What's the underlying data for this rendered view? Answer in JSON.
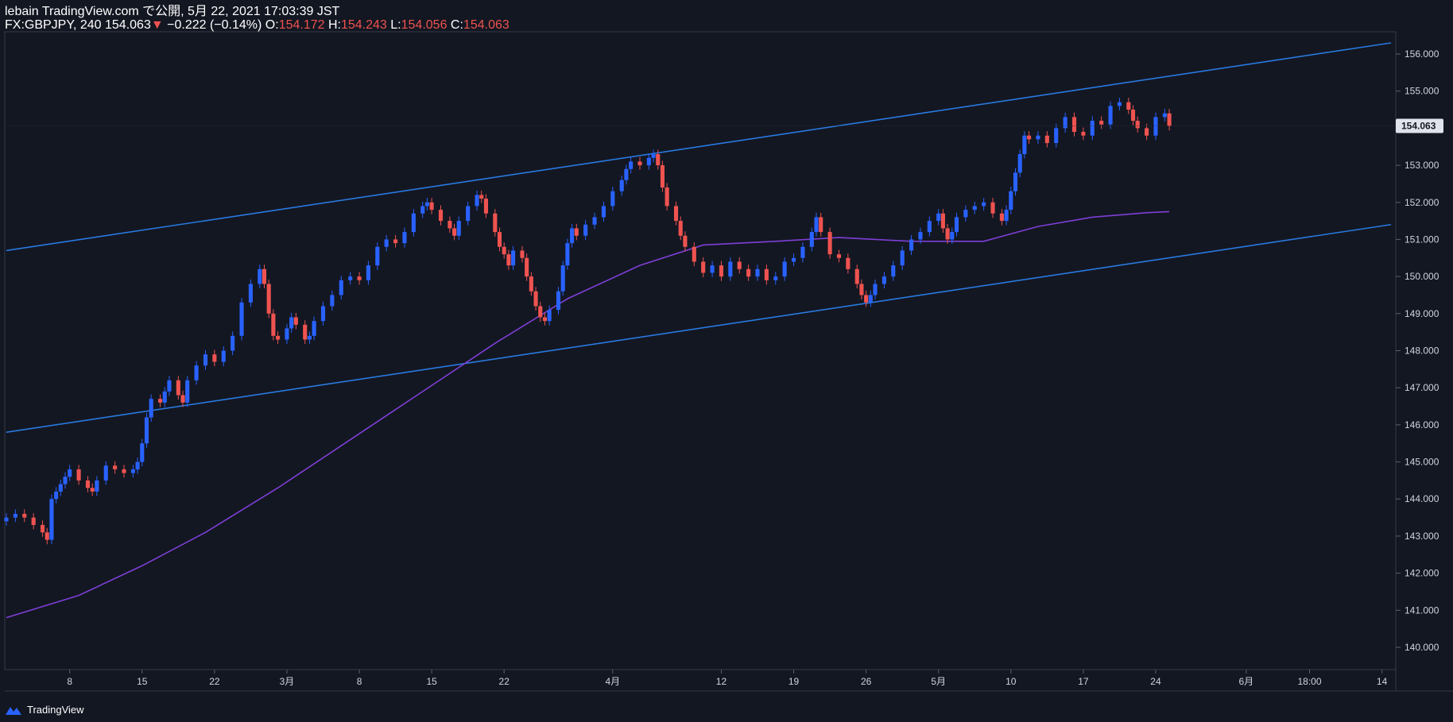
{
  "header": {
    "line1": "lebain TradingView.com で公開, 5月 22, 2021 17:03:39 JST",
    "symbol": "FX:GBPJPY, 240",
    "last": "154.063",
    "change_arrow": "▼",
    "change": "−0.222 (−0.14%)",
    "o_label": "O:",
    "o": "154.172",
    "h_label": "H:",
    "h": "154.243",
    "l_label": "L:",
    "l": "154.056",
    "c_label": "C:",
    "c": "154.063"
  },
  "footer": {
    "brand": "TradingView"
  },
  "colors": {
    "background": "#131722",
    "up": "#2962ff",
    "down": "#ef5350",
    "channel": "#2979e0",
    "ma": "#7e3fd6",
    "axis_text": "#d1d4dc",
    "price_label_bg": "#e0e3eb"
  },
  "chart_data": {
    "type": "candlestick",
    "symbol": "GBPJPY",
    "timeframe": "240",
    "y_range": [
      139.4,
      156.6
    ],
    "x_range": [
      0,
      153
    ],
    "y_ticks": [
      "140.000",
      "141.000",
      "142.000",
      "143.000",
      "144.000",
      "145.000",
      "146.000",
      "147.000",
      "148.000",
      "149.000",
      "150.000",
      "151.000",
      "152.000",
      "153.000",
      "154.000",
      "155.000",
      "156.000"
    ],
    "x_ticks": [
      {
        "label": "8",
        "x": 7
      },
      {
        "label": "15",
        "x": 15
      },
      {
        "label": "22",
        "x": 23
      },
      {
        "label": "3月",
        "x": 31
      },
      {
        "label": "8",
        "x": 39
      },
      {
        "label": "15",
        "x": 47
      },
      {
        "label": "22",
        "x": 55
      },
      {
        "label": "4月",
        "x": 67
      },
      {
        "label": "12",
        "x": 79
      },
      {
        "label": "19",
        "x": 87
      },
      {
        "label": "26",
        "x": 95
      },
      {
        "label": "5月",
        "x": 103
      },
      {
        "label": "10",
        "x": 111
      },
      {
        "label": "17",
        "x": 119
      },
      {
        "label": "24",
        "x": 127
      },
      {
        "label": "6月",
        "x": 137
      },
      {
        "label": "18:00",
        "x": 144
      },
      {
        "label": "14",
        "x": 152
      }
    ],
    "last_price": "154.063",
    "closes": [
      {
        "x": 0.0,
        "c": 143.5
      },
      {
        "x": 1.0,
        "c": 143.6
      },
      {
        "x": 2.0,
        "c": 143.5
      },
      {
        "x": 3.0,
        "c": 143.3
      },
      {
        "x": 4.0,
        "c": 143.1
      },
      {
        "x": 4.5,
        "c": 142.9
      },
      {
        "x": 5.0,
        "c": 144.0
      },
      {
        "x": 5.5,
        "c": 144.2
      },
      {
        "x": 6.0,
        "c": 144.4
      },
      {
        "x": 6.5,
        "c": 144.6
      },
      {
        "x": 7.0,
        "c": 144.8
      },
      {
        "x": 8.0,
        "c": 144.5
      },
      {
        "x": 9.0,
        "c": 144.3
      },
      {
        "x": 9.5,
        "c": 144.2
      },
      {
        "x": 10.0,
        "c": 144.5
      },
      {
        "x": 11.0,
        "c": 144.9
      },
      {
        "x": 12.0,
        "c": 144.8
      },
      {
        "x": 13.0,
        "c": 144.7
      },
      {
        "x": 14.0,
        "c": 144.8
      },
      {
        "x": 14.5,
        "c": 145.0
      },
      {
        "x": 15.0,
        "c": 145.5
      },
      {
        "x": 15.5,
        "c": 146.2
      },
      {
        "x": 16.0,
        "c": 146.7
      },
      {
        "x": 17.0,
        "c": 146.6
      },
      {
        "x": 17.5,
        "c": 146.9
      },
      {
        "x": 18.0,
        "c": 147.2
      },
      {
        "x": 19.0,
        "c": 146.8
      },
      {
        "x": 19.5,
        "c": 146.6
      },
      {
        "x": 20.0,
        "c": 147.2
      },
      {
        "x": 21.0,
        "c": 147.6
      },
      {
        "x": 22.0,
        "c": 147.9
      },
      {
        "x": 23.0,
        "c": 147.7
      },
      {
        "x": 24.0,
        "c": 148.0
      },
      {
        "x": 25.0,
        "c": 148.4
      },
      {
        "x": 26.0,
        "c": 149.3
      },
      {
        "x": 27.0,
        "c": 149.8
      },
      {
        "x": 28.0,
        "c": 150.2
      },
      {
        "x": 28.5,
        "c": 149.8
      },
      {
        "x": 29.0,
        "c": 149.0
      },
      {
        "x": 29.5,
        "c": 148.4
      },
      {
        "x": 30.0,
        "c": 148.3
      },
      {
        "x": 31.0,
        "c": 148.6
      },
      {
        "x": 31.5,
        "c": 148.9
      },
      {
        "x": 32.0,
        "c": 148.7
      },
      {
        "x": 33.0,
        "c": 148.3
      },
      {
        "x": 33.5,
        "c": 148.4
      },
      {
        "x": 34.0,
        "c": 148.8
      },
      {
        "x": 35.0,
        "c": 149.2
      },
      {
        "x": 36.0,
        "c": 149.5
      },
      {
        "x": 37.0,
        "c": 149.9
      },
      {
        "x": 38.0,
        "c": 150.0
      },
      {
        "x": 39.0,
        "c": 149.9
      },
      {
        "x": 40.0,
        "c": 150.3
      },
      {
        "x": 41.0,
        "c": 150.8
      },
      {
        "x": 42.0,
        "c": 151.0
      },
      {
        "x": 43.0,
        "c": 150.9
      },
      {
        "x": 44.0,
        "c": 151.2
      },
      {
        "x": 45.0,
        "c": 151.7
      },
      {
        "x": 46.0,
        "c": 151.9
      },
      {
        "x": 46.5,
        "c": 152.0
      },
      {
        "x": 47.0,
        "c": 151.8
      },
      {
        "x": 48.0,
        "c": 151.5
      },
      {
        "x": 49.0,
        "c": 151.3
      },
      {
        "x": 49.5,
        "c": 151.1
      },
      {
        "x": 50.0,
        "c": 151.5
      },
      {
        "x": 51.0,
        "c": 151.9
      },
      {
        "x": 52.0,
        "c": 152.2
      },
      {
        "x": 52.5,
        "c": 152.1
      },
      {
        "x": 53.0,
        "c": 151.7
      },
      {
        "x": 54.0,
        "c": 151.2
      },
      {
        "x": 54.5,
        "c": 150.8
      },
      {
        "x": 55.0,
        "c": 150.6
      },
      {
        "x": 55.5,
        "c": 150.3
      },
      {
        "x": 56.0,
        "c": 150.7
      },
      {
        "x": 57.0,
        "c": 150.5
      },
      {
        "x": 57.5,
        "c": 150.0
      },
      {
        "x": 58.0,
        "c": 149.6
      },
      {
        "x": 58.5,
        "c": 149.2
      },
      {
        "x": 59.0,
        "c": 148.9
      },
      {
        "x": 59.5,
        "c": 148.8
      },
      {
        "x": 60.0,
        "c": 149.1
      },
      {
        "x": 61.0,
        "c": 149.6
      },
      {
        "x": 61.5,
        "c": 150.3
      },
      {
        "x": 62.0,
        "c": 150.9
      },
      {
        "x": 62.5,
        "c": 151.3
      },
      {
        "x": 63.0,
        "c": 151.1
      },
      {
        "x": 64.0,
        "c": 151.4
      },
      {
        "x": 65.0,
        "c": 151.6
      },
      {
        "x": 66.0,
        "c": 151.9
      },
      {
        "x": 67.0,
        "c": 152.3
      },
      {
        "x": 68.0,
        "c": 152.6
      },
      {
        "x": 68.5,
        "c": 152.9
      },
      {
        "x": 69.0,
        "c": 153.1
      },
      {
        "x": 70.0,
        "c": 153.0
      },
      {
        "x": 71.0,
        "c": 153.2
      },
      {
        "x": 71.5,
        "c": 153.3
      },
      {
        "x": 72.0,
        "c": 153.0
      },
      {
        "x": 72.5,
        "c": 152.4
      },
      {
        "x": 73.0,
        "c": 151.9
      },
      {
        "x": 74.0,
        "c": 151.5
      },
      {
        "x": 74.5,
        "c": 151.1
      },
      {
        "x": 75.0,
        "c": 150.8
      },
      {
        "x": 76.0,
        "c": 150.4
      },
      {
        "x": 77.0,
        "c": 150.1
      },
      {
        "x": 78.0,
        "c": 150.3
      },
      {
        "x": 79.0,
        "c": 150.0
      },
      {
        "x": 80.0,
        "c": 150.4
      },
      {
        "x": 81.0,
        "c": 150.2
      },
      {
        "x": 82.0,
        "c": 150.0
      },
      {
        "x": 83.0,
        "c": 150.2
      },
      {
        "x": 84.0,
        "c": 149.9
      },
      {
        "x": 85.0,
        "c": 150.0
      },
      {
        "x": 86.0,
        "c": 150.4
      },
      {
        "x": 87.0,
        "c": 150.5
      },
      {
        "x": 88.0,
        "c": 150.8
      },
      {
        "x": 89.0,
        "c": 151.2
      },
      {
        "x": 89.5,
        "c": 151.6
      },
      {
        "x": 90.0,
        "c": 151.2
      },
      {
        "x": 91.0,
        "c": 150.6
      },
      {
        "x": 92.0,
        "c": 150.5
      },
      {
        "x": 93.0,
        "c": 150.2
      },
      {
        "x": 94.0,
        "c": 149.8
      },
      {
        "x": 94.5,
        "c": 149.5
      },
      {
        "x": 95.0,
        "c": 149.3
      },
      {
        "x": 95.5,
        "c": 149.5
      },
      {
        "x": 96.0,
        "c": 149.8
      },
      {
        "x": 97.0,
        "c": 150.0
      },
      {
        "x": 98.0,
        "c": 150.3
      },
      {
        "x": 99.0,
        "c": 150.7
      },
      {
        "x": 100.0,
        "c": 151.0
      },
      {
        "x": 101.0,
        "c": 151.2
      },
      {
        "x": 102.0,
        "c": 151.5
      },
      {
        "x": 103.0,
        "c": 151.7
      },
      {
        "x": 103.5,
        "c": 151.3
      },
      {
        "x": 104.0,
        "c": 151.0
      },
      {
        "x": 104.5,
        "c": 151.2
      },
      {
        "x": 105.0,
        "c": 151.6
      },
      {
        "x": 106.0,
        "c": 151.8
      },
      {
        "x": 107.0,
        "c": 151.9
      },
      {
        "x": 108.0,
        "c": 152.0
      },
      {
        "x": 109.0,
        "c": 151.7
      },
      {
        "x": 110.0,
        "c": 151.5
      },
      {
        "x": 110.5,
        "c": 151.8
      },
      {
        "x": 111.0,
        "c": 152.3
      },
      {
        "x": 111.5,
        "c": 152.8
      },
      {
        "x": 112.0,
        "c": 153.3
      },
      {
        "x": 112.5,
        "c": 153.8
      },
      {
        "x": 113.0,
        "c": 153.7
      },
      {
        "x": 114.0,
        "c": 153.8
      },
      {
        "x": 115.0,
        "c": 153.6
      },
      {
        "x": 116.0,
        "c": 154.0
      },
      {
        "x": 117.0,
        "c": 154.3
      },
      {
        "x": 118.0,
        "c": 153.9
      },
      {
        "x": 119.0,
        "c": 153.8
      },
      {
        "x": 120.0,
        "c": 154.2
      },
      {
        "x": 121.0,
        "c": 154.1
      },
      {
        "x": 122.0,
        "c": 154.6
      },
      {
        "x": 123.0,
        "c": 154.7
      },
      {
        "x": 124.0,
        "c": 154.5
      },
      {
        "x": 124.5,
        "c": 154.2
      },
      {
        "x": 125.0,
        "c": 154.0
      },
      {
        "x": 126.0,
        "c": 153.8
      },
      {
        "x": 127.0,
        "c": 154.3
      },
      {
        "x": 128.0,
        "c": 154.4
      },
      {
        "x": 128.5,
        "c": 154.06
      }
    ],
    "channel_upper": [
      {
        "x": 0,
        "y": 150.7
      },
      {
        "x": 153,
        "y": 156.3
      }
    ],
    "channel_lower": [
      {
        "x": 0,
        "y": 145.8
      },
      {
        "x": 153,
        "y": 151.4
      }
    ],
    "ma": [
      {
        "x": 0,
        "y": 140.8
      },
      {
        "x": 8,
        "y": 141.4
      },
      {
        "x": 15,
        "y": 142.2
      },
      {
        "x": 22,
        "y": 143.1
      },
      {
        "x": 30,
        "y": 144.3
      },
      {
        "x": 38,
        "y": 145.6
      },
      {
        "x": 46,
        "y": 146.9
      },
      {
        "x": 54,
        "y": 148.2
      },
      {
        "x": 62,
        "y": 149.4
      },
      {
        "x": 70,
        "y": 150.3
      },
      {
        "x": 77,
        "y": 150.85
      },
      {
        "x": 85,
        "y": 150.95
      },
      {
        "x": 92,
        "y": 151.05
      },
      {
        "x": 100,
        "y": 150.95
      },
      {
        "x": 108,
        "y": 150.95
      },
      {
        "x": 114,
        "y": 151.35
      },
      {
        "x": 120,
        "y": 151.6
      },
      {
        "x": 126,
        "y": 151.72
      },
      {
        "x": 128.5,
        "y": 151.75
      }
    ]
  }
}
